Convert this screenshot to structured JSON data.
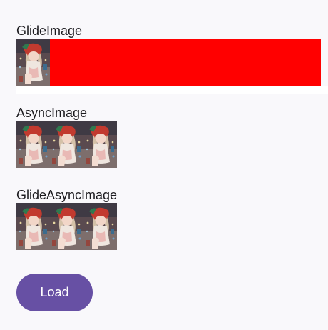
{
  "sections": [
    {
      "title": "GlideImage",
      "image_count": 1,
      "placeholder_color": "#ff0000"
    },
    {
      "title": "AsyncImage",
      "image_count": 3
    },
    {
      "title": "GlideAsyncImage",
      "image_count": 3
    }
  ],
  "load_button": {
    "label": "Load"
  },
  "colors": {
    "background": "#f9f8fb",
    "accent": "#6750a4",
    "error_placeholder": "#ff0000",
    "text": "#1c1b1f"
  },
  "thumbnail_icon": "anime-girl-illustration"
}
